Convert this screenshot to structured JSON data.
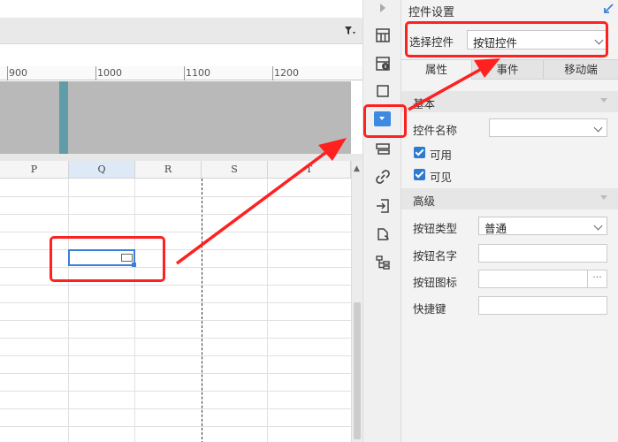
{
  "ruler": {
    "labels": [
      "900",
      "1000",
      "1100",
      "1200"
    ]
  },
  "sheet": {
    "columns": [
      "P",
      "Q",
      "R",
      "S",
      "T"
    ],
    "selected_column": "Q"
  },
  "panel": {
    "title": "控件设置",
    "select_label": "选择控件",
    "select_value": "按钮控件",
    "tabs": [
      "属性",
      "事件",
      "移动端"
    ],
    "sections": {
      "basic": {
        "title": "基本",
        "name_label": "控件名称",
        "name_value": "",
        "enabled_label": "可用",
        "visible_label": "可见"
      },
      "advanced": {
        "title": "高级",
        "button_type_label": "按钮类型",
        "button_type_value": "普通",
        "button_name_label": "按钮名字",
        "button_icon_label": "按钮图标",
        "button_icon_more": "···",
        "shortcut_label": "快捷键"
      }
    }
  },
  "colors": {
    "annotation": "#ff2020",
    "accent": "#2f7ad1"
  }
}
